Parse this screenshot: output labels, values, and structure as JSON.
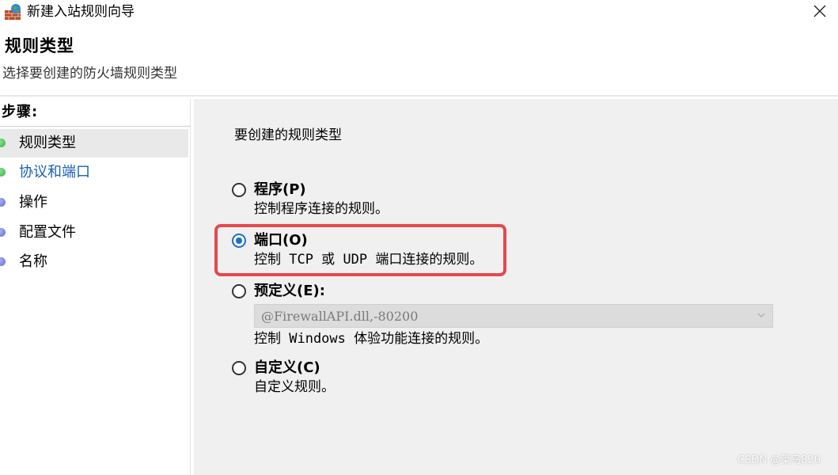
{
  "window": {
    "title": "新建入站规则向导",
    "icon": "firewall-globe-icon",
    "close_icon": "close-icon"
  },
  "header": {
    "title": "规则类型",
    "subtitle": "选择要创建的防火墙规则类型"
  },
  "sidebar": {
    "title": "步骤:",
    "items": [
      {
        "label": "规则类型",
        "state": "current",
        "dot_color": "#3cb043"
      },
      {
        "label": "协议和端口",
        "state": "link",
        "dot_color": "#3cb043"
      },
      {
        "label": "操作",
        "state": "normal",
        "dot_color": "#5b6bd6"
      },
      {
        "label": "配置文件",
        "state": "normal",
        "dot_color": "#5b6bd6"
      },
      {
        "label": "名称",
        "state": "normal",
        "dot_color": "#5b6bd6"
      }
    ]
  },
  "main": {
    "prompt": "要创建的规则类型",
    "options": [
      {
        "label": "程序(P)",
        "description": "控制程序连接的规则。",
        "checked": false
      },
      {
        "label": "端口(O)",
        "description": "控制 TCP 或 UDP 端口连接的规则。",
        "checked": true
      },
      {
        "label": "预定义(E):",
        "description": "控制 Windows 体验功能连接的规则。",
        "checked": false,
        "dropdown": {
          "value": "@FirewallAPI.dll,-80200",
          "disabled": true
        }
      },
      {
        "label": "自定义(C)",
        "description": "自定义规则。",
        "checked": false
      }
    ]
  },
  "watermark": "CSDN @菜鸟820",
  "colors": {
    "accent": "#1a6fd0",
    "highlight": "#e5484d",
    "link": "#1a5fb4",
    "panel_bg": "#f0f0f0"
  }
}
